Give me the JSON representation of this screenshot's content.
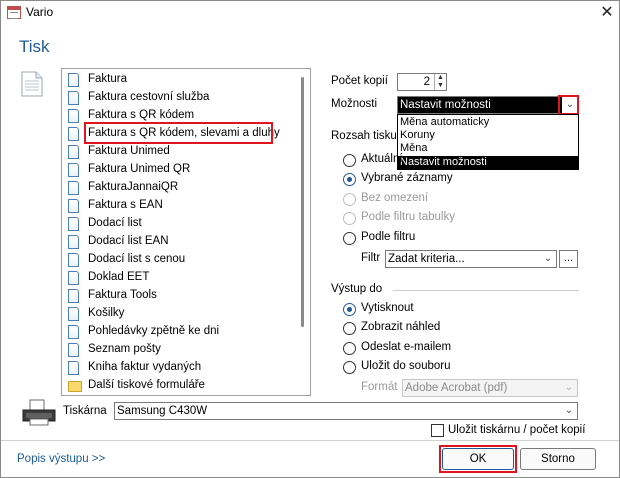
{
  "window": {
    "title": "Vario",
    "close_icon": "close-icon"
  },
  "page": {
    "heading": "Tisk"
  },
  "forms": [
    {
      "label": "Faktura",
      "icon": "document-icon"
    },
    {
      "label": "Faktura cestovní služba",
      "icon": "document-icon"
    },
    {
      "label": "Faktura s QR kódem",
      "icon": "document-icon"
    },
    {
      "label": "Faktura s QR kódem, slevami a dluhy",
      "icon": "document-icon"
    },
    {
      "label": "Faktura Unimed",
      "icon": "document-icon"
    },
    {
      "label": "Faktura Unimed QR",
      "icon": "document-icon"
    },
    {
      "label": "FakturaJannaiQR",
      "icon": "document-icon"
    },
    {
      "label": "Faktura s EAN",
      "icon": "document-icon"
    },
    {
      "label": "Dodací list",
      "icon": "document-icon"
    },
    {
      "label": "Dodací list EAN",
      "icon": "document-icon"
    },
    {
      "label": "Dodací list s cenou",
      "icon": "document-icon"
    },
    {
      "label": "Doklad EET",
      "icon": "document-icon"
    },
    {
      "label": "Faktura Tools",
      "icon": "document-icon"
    },
    {
      "label": "Košilky",
      "icon": "document-icon"
    },
    {
      "label": "Pohledávky zpětně ke dni",
      "icon": "document-icon"
    },
    {
      "label": "Seznam pošty",
      "icon": "document-icon"
    },
    {
      "label": "Kniha faktur vydaných",
      "icon": "document-icon"
    },
    {
      "label": "Další tiskové formuláře",
      "icon": "folder-icon"
    }
  ],
  "options": {
    "copies_label": "Počet kopií",
    "copies_value": "2",
    "possibilities_label": "Možnosti",
    "possibilities_value": "Nastavit možnosti",
    "possibilities_options": [
      "Měna automaticky",
      "Koruny",
      "Měna",
      "Nastavit možnosti"
    ],
    "range_label": "Rozsah tisku",
    "range_options": [
      {
        "label": "Aktuální",
        "checked": false,
        "disabled": false
      },
      {
        "label": "Vybrané záznamy",
        "checked": true,
        "disabled": false
      },
      {
        "label": "Bez omezení",
        "checked": false,
        "disabled": true
      },
      {
        "label": "Podle filtru tabulky",
        "checked": false,
        "disabled": true
      },
      {
        "label": "Podle filtru",
        "checked": false,
        "disabled": false
      }
    ],
    "filter_label": "Filtr",
    "filter_value": "Zadat kriteria...",
    "filter_more_label": "...",
    "output_label": "Výstup do",
    "output_options": [
      {
        "label": "Vytisknout",
        "checked": true
      },
      {
        "label": "Zobrazit náhled",
        "checked": false
      },
      {
        "label": "Odeslat e-mailem",
        "checked": false
      },
      {
        "label": "Uložit do souboru",
        "checked": false
      }
    ],
    "format_label": "Formát",
    "format_value": "Adobe Acrobat (pdf)"
  },
  "printer": {
    "label": "Tiskárna",
    "value": "Samsung C430W",
    "save_label": "Uložit tiskárnu / počet kopií"
  },
  "footer": {
    "link": "Popis výstupu >>",
    "ok": "OK",
    "cancel": "Storno"
  },
  "colors": {
    "accent": "#1f5b99",
    "highlight_border": "#e0141e"
  }
}
